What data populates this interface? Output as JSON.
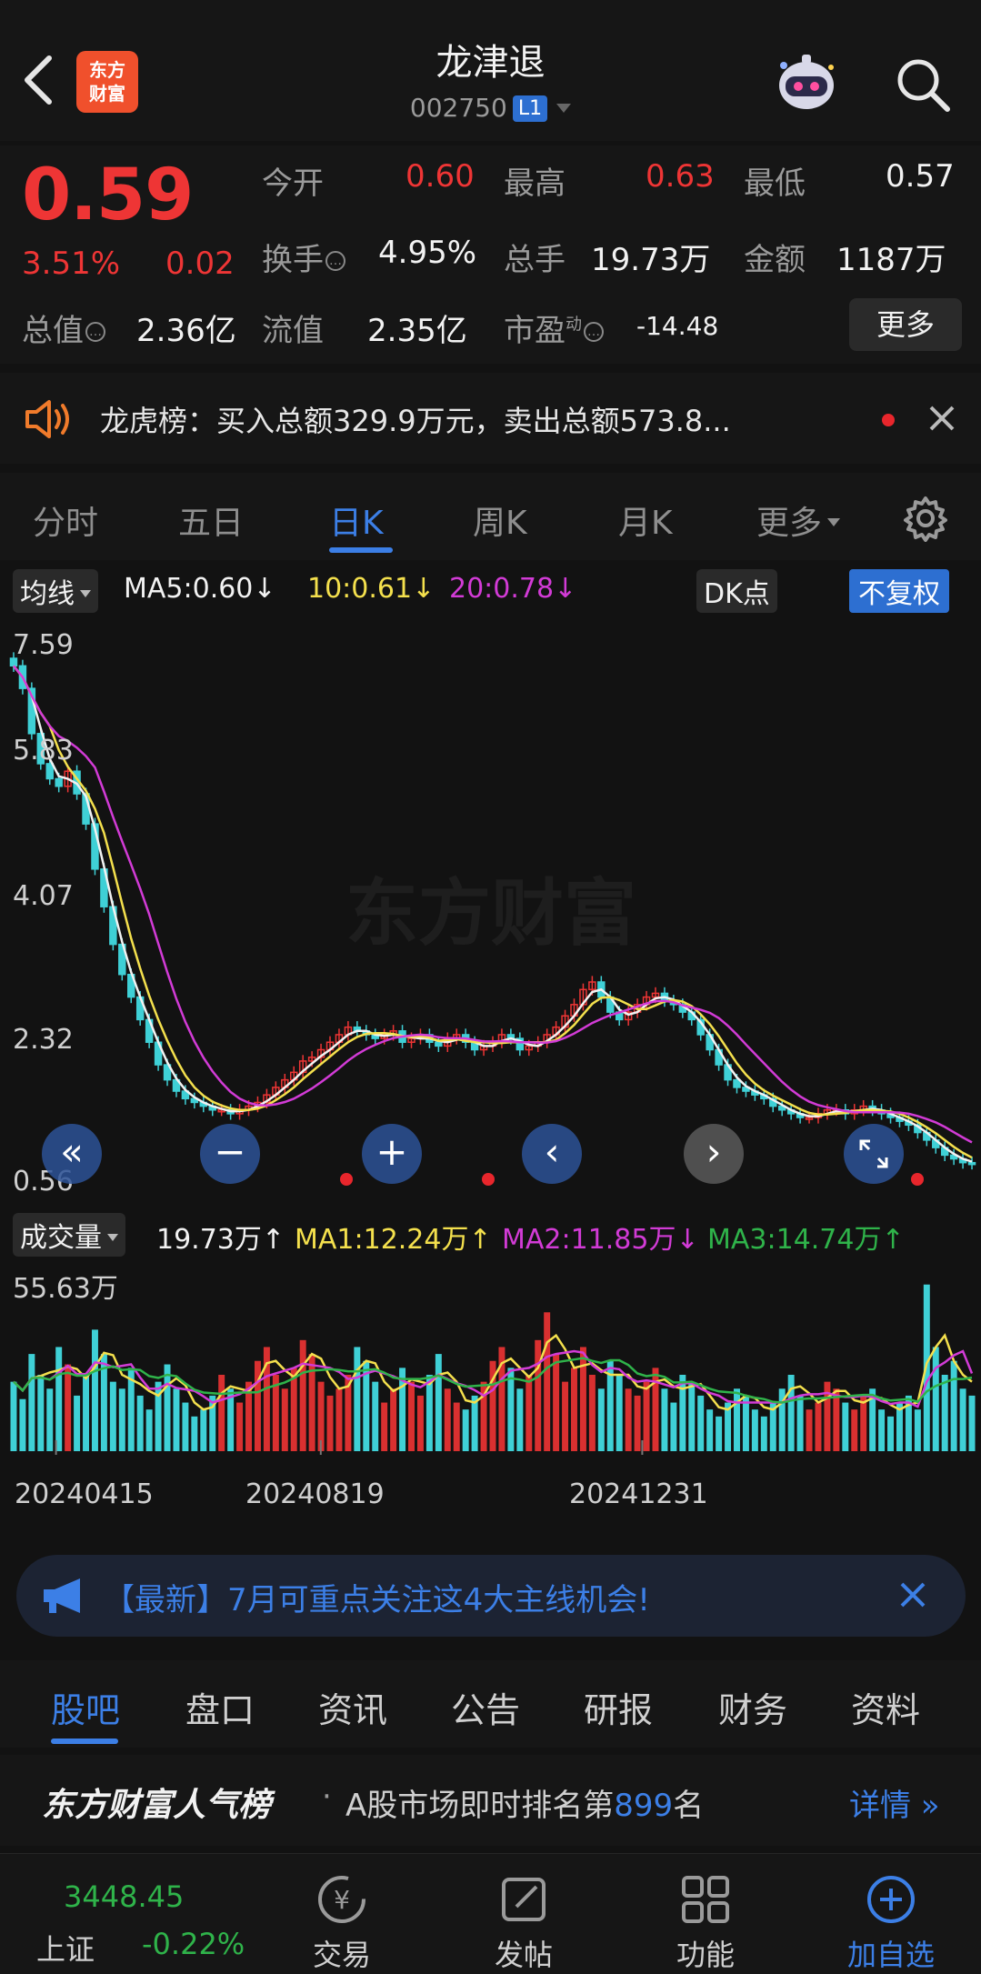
{
  "header": {
    "title": "龙津退",
    "code": "002750",
    "level": "L1",
    "logo_line1": "东方",
    "logo_line2": "财富"
  },
  "quote": {
    "price": "0.59",
    "change_pct": "3.51%",
    "change_amt": "0.02",
    "open_label": "今开",
    "open": "0.60",
    "high_label": "最高",
    "high": "0.63",
    "low_label": "最低",
    "low": "0.57",
    "turnover_label": "换手",
    "turnover": "4.95%",
    "volume_label": "总手",
    "volume": "19.73万",
    "amount_label": "金额",
    "amount": "1187万",
    "mcap_label": "总值",
    "mcap": "2.36亿",
    "float_label": "流值",
    "float": "2.35亿",
    "pe_label": "市盈",
    "pe_sup": "动",
    "pe": "-14.48",
    "more_label": "更多"
  },
  "dragon_tiger": {
    "text": "龙虎榜：买入总额329.9万元，卖出总额573.8..."
  },
  "chart_tabs": {
    "items": [
      "分时",
      "五日",
      "日K",
      "周K",
      "月K",
      "更多"
    ],
    "active": "日K"
  },
  "ma_legend": {
    "selector": "均线",
    "ma5": "MA5:0.60",
    "ma10": "10:0.61",
    "ma20": "20:0.78",
    "dk_label": "DK点",
    "adjust_label": "不复权",
    "down_arrow": "↓"
  },
  "price_axis": [
    "7.59",
    "5.83",
    "4.07",
    "2.32",
    "0.56"
  ],
  "volume_legend": {
    "selector": "成交量",
    "vol": "19.73万",
    "ma1": "MA1:12.24万",
    "ma2": "MA2:11.85万",
    "ma3": "MA3:14.74万",
    "up_arrow": "↑",
    "down_arrow": "↓"
  },
  "volume_axis_max": "55.63万",
  "dates": [
    "20240415",
    "20240819",
    "20241231"
  ],
  "chart_controls": {
    "rewind": "«",
    "zoom_out": "−",
    "zoom_in": "+",
    "prev": "‹",
    "next": "›"
  },
  "news_banner": {
    "text": "【最新】7月可重点关注这4大主线机会!"
  },
  "bottom_tabs": {
    "items": [
      "股吧",
      "盘口",
      "资讯",
      "公告",
      "研报",
      "财务",
      "资料"
    ],
    "active": "股吧"
  },
  "ranking": {
    "brand": "东方财富人气榜",
    "dot": "·",
    "text_prefix": "A股市场即时排名第",
    "rank": "899",
    "text_suffix": "名",
    "link": "详情 »"
  },
  "bottom_bar": {
    "index_value": "3448.45",
    "index_name": "上证",
    "index_change": "-0.22%",
    "items": [
      "交易",
      "发帖",
      "功能",
      "加自选"
    ]
  },
  "chart_data": {
    "type": "candlestick",
    "price_axis_ticks": [
      7.59,
      5.83,
      4.07,
      2.32,
      0.56
    ],
    "ma_colors": {
      "ma5": "#f2f2f2",
      "ma10": "#f4e04d",
      "ma20": "#d23bd6"
    },
    "close_series": [
      7.2,
      6.9,
      6.3,
      5.9,
      5.7,
      5.6,
      5.8,
      5.5,
      5.1,
      4.5,
      4.0,
      3.5,
      3.1,
      2.8,
      2.5,
      2.2,
      1.9,
      1.7,
      1.55,
      1.45,
      1.4,
      1.35,
      1.3,
      1.3,
      1.25,
      1.3,
      1.35,
      1.4,
      1.5,
      1.6,
      1.7,
      1.8,
      1.95,
      2.0,
      2.1,
      2.2,
      2.3,
      2.4,
      2.35,
      2.3,
      2.25,
      2.3,
      2.35,
      2.2,
      2.25,
      2.3,
      2.2,
      2.15,
      2.25,
      2.3,
      2.2,
      2.1,
      2.15,
      2.2,
      2.3,
      2.25,
      2.1,
      2.15,
      2.2,
      2.3,
      2.4,
      2.55,
      2.7,
      2.9,
      3.0,
      2.8,
      2.6,
      2.5,
      2.6,
      2.7,
      2.8,
      2.85,
      2.75,
      2.7,
      2.6,
      2.5,
      2.3,
      2.1,
      1.9,
      1.7,
      1.6,
      1.55,
      1.5,
      1.45,
      1.35,
      1.3,
      1.25,
      1.2,
      1.2,
      1.25,
      1.3,
      1.3,
      1.25,
      1.3,
      1.35,
      1.3,
      1.25,
      1.2,
      1.15,
      1.1,
      1.0,
      0.9,
      0.8,
      0.7,
      0.65,
      0.6,
      0.59
    ],
    "volume_series": [
      20,
      15,
      28,
      22,
      18,
      30,
      25,
      16,
      22,
      35,
      28,
      20,
      18,
      24,
      16,
      12,
      20,
      25,
      18,
      14,
      10,
      12,
      16,
      22,
      18,
      14,
      20,
      26,
      30,
      22,
      18,
      24,
      32,
      28,
      20,
      16,
      18,
      22,
      30,
      26,
      20,
      14,
      18,
      24,
      20,
      16,
      22,
      28,
      18,
      14,
      12,
      16,
      20,
      26,
      30,
      24,
      18,
      22,
      32,
      40,
      28,
      20,
      24,
      30,
      22,
      18,
      26,
      22,
      18,
      16,
      20,
      24,
      18,
      14,
      22,
      20,
      16,
      12,
      10,
      14,
      18,
      16,
      12,
      10,
      14,
      18,
      22,
      16,
      12,
      14,
      20,
      18,
      14,
      12,
      16,
      18,
      12,
      10,
      14,
      16,
      12,
      48,
      30,
      22,
      26,
      18,
      16
    ],
    "volume_axis_max": "55.63万",
    "dates": [
      "20240415",
      "20240819",
      "20241231"
    ]
  }
}
